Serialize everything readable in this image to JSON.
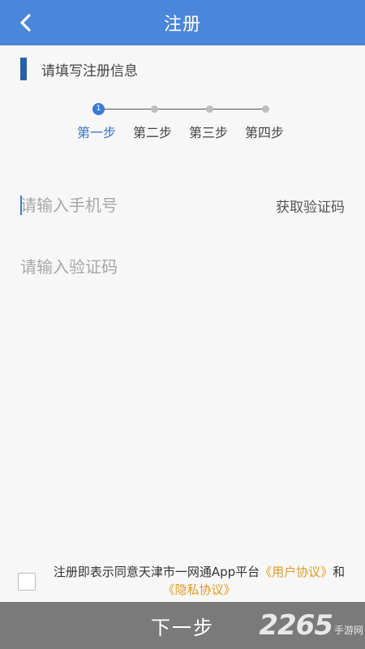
{
  "header": {
    "title": "注册"
  },
  "section": {
    "title": "请填写注册信息"
  },
  "stepper": {
    "current_step": 1,
    "active_dot_text": "1",
    "steps": [
      "第一步",
      "第二步",
      "第三步",
      "第四步"
    ]
  },
  "form": {
    "phone": {
      "value": "",
      "placeholder": "请输入手机号"
    },
    "get_code_label": "获取验证码",
    "code": {
      "value": "",
      "placeholder": "请输入验证码"
    }
  },
  "agreement": {
    "checked": false,
    "prefix": "注册即表示同意天津市一网通App平台",
    "user_agreement": "《用户协议》",
    "conjunction": "和",
    "privacy_agreement": "《隐私协议》"
  },
  "footer": {
    "next_label": "下一步"
  },
  "watermark": {
    "number": "2265",
    "text": "手游网"
  },
  "colors": {
    "header_bg": "#4a86d9",
    "accent": "#3a7bd5",
    "section_bar": "#2a5fa8",
    "link": "#e09a1e",
    "bottom_bar": "#7a7a7a"
  },
  "icons": {
    "back": "chevron-left-icon"
  }
}
